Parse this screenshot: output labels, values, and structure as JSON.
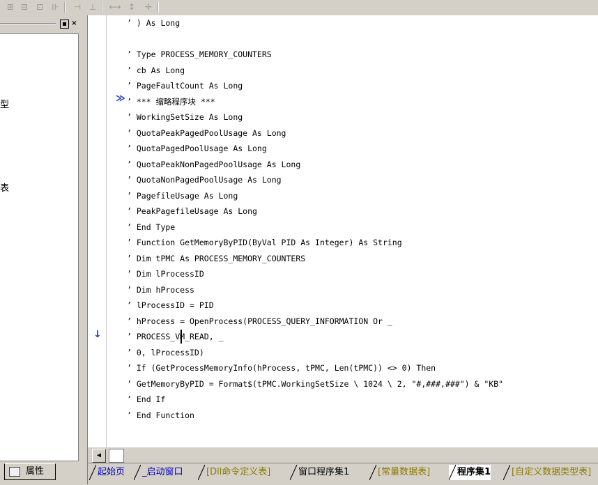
{
  "toolbar": {
    "icons": [
      "align-left-icon",
      "align-center-icon",
      "align-right-icon",
      "distribute-icon",
      "same-width-icon",
      "same-height-icon",
      "stretch-horizontal-icon",
      "stretch-vertical-icon",
      "stretch-both-icon"
    ]
  },
  "left_panel": {
    "tree_fragments": [
      "型",
      "表"
    ]
  },
  "editor": {
    "lines": [
      "’ ) As Long",
      "",
      "’ Type PROCESS_MEMORY_COUNTERS",
      "’ cb As Long",
      "’ PageFaultCount As Long",
      "’ *** 缩略程序块 ***",
      "’ WorkingSetSize As Long",
      "’ QuotaPeakPagedPoolUsage As Long",
      "’ QuotaPagedPoolUsage As Long",
      "’ QuotaPeakNonPagedPoolUsage As Long",
      "’ QuotaNonPagedPoolUsage As Long",
      "’ PagefileUsage As Long",
      "’ PeakPagefileUsage As Long",
      "’ End Type",
      "’ Function GetMemoryByPID(ByVal PID As Integer) As String",
      "’ Dim tPMC As PROCESS_MEMORY_COUNTERS",
      "’ Dim lProcessID",
      "’ Dim hProcess",
      "’ lProcessID = PID",
      "’ hProcess = OpenProcess(PROCESS_QUERY_INFORMATION Or _",
      "’ PROCESS_VM_READ, _",
      "’ 0, lProcessID)",
      "’ If (GetProcessMemoryInfo(hProcess, tPMC, Len(tPMC)) <> 0) Then",
      "’ GetMemoryByPID = Format$(tPMC.WorkingSetSize \\ 1024 \\ 2, \"#,###,###\") & \"KB\"",
      "’ End If",
      "’ End Function"
    ],
    "collapse_marker": "≫",
    "current_line_marker": "↓"
  },
  "bottom": {
    "props_label": "属性",
    "tabs": [
      "起始页",
      "_启动窗口",
      "[Dll命令定义表]",
      "窗口程序集1",
      "[常量数据表]",
      "程序集1",
      "[自定义数据类型表]"
    ],
    "active_tab": "程序集1"
  },
  "colors": {
    "tab_blue": "#0000c0",
    "tab_olive": "#8a7a00",
    "marker_blue": "#1a3fb0"
  }
}
